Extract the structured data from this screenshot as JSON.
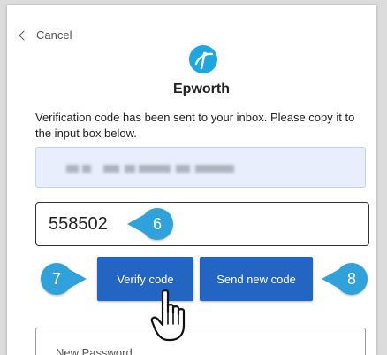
{
  "nav": {
    "cancel_label": "Cancel"
  },
  "brand": {
    "name": "Epworth",
    "logo_icon": "epworth-logo-icon",
    "logo_color": "#1da6e0"
  },
  "verification": {
    "message": "Verification code has been sent to your inbox. Please copy it to the input box below.",
    "code_value": "558502"
  },
  "actions": {
    "verify_label": "Verify code",
    "send_new_label": "Send new code",
    "button_color": "#2365c3"
  },
  "password": {
    "placeholder": "New Password"
  },
  "callouts": {
    "code_step": "6",
    "verify_step": "7",
    "send_new_step": "8",
    "color": "#2fa2dc"
  },
  "cursor": {
    "icon": "hand-pointer-icon"
  }
}
